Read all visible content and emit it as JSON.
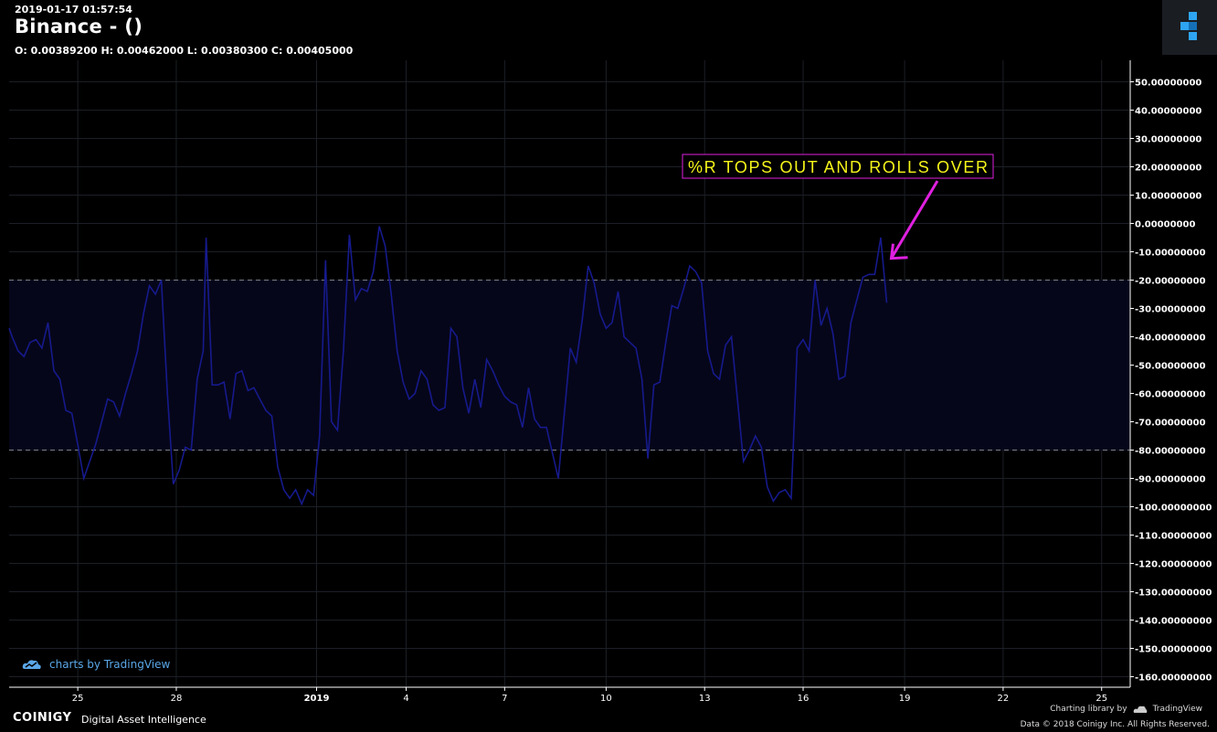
{
  "header": {
    "datetime": "2019-01-17 01:57:54",
    "title": "Binance -  ()",
    "ohlc": "O: 0.00389200 H: 0.00462000 L: 0.00380300 C: 0.00405000"
  },
  "annotation": {
    "text": "%R TOPS OUT AND ROLLS OVER",
    "text_color": "#f5f51a",
    "border_color": "#e020e0",
    "arrow_color": "#e020e0",
    "arrow_target": {
      "x": 101.0,
      "y": -12
    }
  },
  "footer": {
    "tradingview": "charts by TradingView",
    "brand": "COINIGY",
    "tagline": "Digital Asset Intelligence",
    "library_credit": "Charting library by",
    "library_name": "TradingView",
    "copyright": "Data © 2018   Coinigy Inc. All Rights Reserved."
  },
  "colors": {
    "background": "#000000",
    "grid": "#1c1f26",
    "line": "#161a8c",
    "band": "#06061a",
    "band_border": "#7a7f8c",
    "axis_text": "#ffffff"
  },
  "chart_data": {
    "type": "line",
    "title": "",
    "xlabel": "",
    "ylabel": "",
    "xlim": [
      78.4,
      113.8
    ],
    "ylim": [
      -165,
      58
    ],
    "y_ticks": [
      50,
      40,
      30,
      20,
      10,
      0,
      -10,
      -20,
      -30,
      -40,
      -50,
      -60,
      -70,
      -80,
      -90,
      -100,
      -110,
      -120,
      -130,
      -140,
      -150,
      -160
    ],
    "y_tick_labels": [
      "50.00000000",
      "40.00000000",
      "30.00000000",
      "20.00000000",
      "10.00000000",
      "0.00000000",
      "-10.00000000",
      "-20.00000000",
      "-30.00000000",
      "-40.00000000",
      "-50.00000000",
      "-60.00000000",
      "-70.00000000",
      "-80.00000000",
      "-90.00000000",
      "-100.00000000",
      "-110.00000000",
      "-120.00000000",
      "-130.00000000",
      "-140.00000000",
      "-150.00000000",
      "-160.00000000"
    ],
    "x_ticks": [
      {
        "x": 80.7,
        "label": "25"
      },
      {
        "x": 84.0,
        "label": "28"
      },
      {
        "x": 88.7,
        "label": "2019"
      },
      {
        "x": 91.7,
        "label": "4"
      },
      {
        "x": 95.0,
        "label": "7"
      },
      {
        "x": 98.4,
        "label": "10"
      },
      {
        "x": 101.7,
        "label": "13"
      },
      {
        "x": 105.0,
        "label": "16"
      },
      {
        "x": 108.4,
        "label": "19"
      },
      {
        "x": 111.7,
        "label": "22"
      },
      {
        "x": 115.0,
        "label": "25"
      }
    ],
    "grid": true,
    "reference_levels": [
      -20,
      -80
    ],
    "series": [
      {
        "values": [
          [
            78.4,
            -37
          ],
          [
            78.5,
            -40
          ],
          [
            78.7,
            -45
          ],
          [
            78.9,
            -47
          ],
          [
            79.1,
            -42
          ],
          [
            79.3,
            -41
          ],
          [
            79.5,
            -44
          ],
          [
            79.7,
            -35
          ],
          [
            79.9,
            -52
          ],
          [
            80.1,
            -55
          ],
          [
            80.3,
            -66
          ],
          [
            80.5,
            -67
          ],
          [
            80.7,
            -78
          ],
          [
            80.9,
            -90
          ],
          [
            81.1,
            -84
          ],
          [
            81.3,
            -78
          ],
          [
            81.5,
            -70
          ],
          [
            81.7,
            -62
          ],
          [
            81.9,
            -63
          ],
          [
            82.1,
            -68
          ],
          [
            82.3,
            -60
          ],
          [
            82.5,
            -53
          ],
          [
            82.7,
            -45
          ],
          [
            82.9,
            -32
          ],
          [
            83.1,
            -22
          ],
          [
            83.3,
            -25
          ],
          [
            83.5,
            -20
          ],
          [
            83.7,
            -60
          ],
          [
            83.9,
            -92
          ],
          [
            84.1,
            -87
          ],
          [
            84.3,
            -79
          ],
          [
            84.5,
            -80
          ],
          [
            84.7,
            -55
          ],
          [
            84.9,
            -45
          ],
          [
            85.0,
            -5
          ],
          [
            85.2,
            -57
          ],
          [
            85.4,
            -57
          ],
          [
            85.6,
            -56
          ],
          [
            85.8,
            -69
          ],
          [
            86.0,
            -53
          ],
          [
            86.2,
            -52
          ],
          [
            86.4,
            -59
          ],
          [
            86.6,
            -58
          ],
          [
            86.8,
            -62
          ],
          [
            87.0,
            -66
          ],
          [
            87.2,
            -68
          ],
          [
            87.4,
            -86
          ],
          [
            87.6,
            -94
          ],
          [
            87.8,
            -97
          ],
          [
            88.0,
            -94
          ],
          [
            88.2,
            -99
          ],
          [
            88.4,
            -94
          ],
          [
            88.6,
            -96
          ],
          [
            88.8,
            -75
          ],
          [
            89.0,
            -13
          ],
          [
            89.2,
            -70
          ],
          [
            89.4,
            -73
          ],
          [
            89.6,
            -45
          ],
          [
            89.8,
            -4
          ],
          [
            90.0,
            -27
          ],
          [
            90.2,
            -23
          ],
          [
            90.4,
            -24
          ],
          [
            90.6,
            -17
          ],
          [
            90.8,
            -1
          ],
          [
            91.0,
            -8
          ],
          [
            91.2,
            -25
          ],
          [
            91.4,
            -45
          ],
          [
            91.6,
            -56
          ],
          [
            91.8,
            -62
          ],
          [
            92.0,
            -60
          ],
          [
            92.2,
            -52
          ],
          [
            92.4,
            -55
          ],
          [
            92.6,
            -64
          ],
          [
            92.8,
            -66
          ],
          [
            93.0,
            -65
          ],
          [
            93.2,
            -37
          ],
          [
            93.4,
            -40
          ],
          [
            93.6,
            -58
          ],
          [
            93.8,
            -67
          ],
          [
            94.0,
            -55
          ],
          [
            94.2,
            -65
          ],
          [
            94.4,
            -48
          ],
          [
            94.6,
            -52
          ],
          [
            94.8,
            -57
          ],
          [
            95.0,
            -61
          ],
          [
            95.2,
            -63
          ],
          [
            95.4,
            -64
          ],
          [
            95.6,
            -72
          ],
          [
            95.8,
            -58
          ],
          [
            96.0,
            -69
          ],
          [
            96.2,
            -72
          ],
          [
            96.4,
            -72
          ],
          [
            96.6,
            -81
          ],
          [
            96.8,
            -90
          ],
          [
            97.0,
            -67
          ],
          [
            97.2,
            -44
          ],
          [
            97.4,
            -49
          ],
          [
            97.6,
            -34
          ],
          [
            97.8,
            -15
          ],
          [
            98.0,
            -21
          ],
          [
            98.2,
            -32
          ],
          [
            98.4,
            -37
          ],
          [
            98.6,
            -35
          ],
          [
            98.8,
            -24
          ],
          [
            99.0,
            -40
          ],
          [
            99.2,
            -42
          ],
          [
            99.4,
            -44
          ],
          [
            99.6,
            -55
          ],
          [
            99.8,
            -83
          ],
          [
            100.0,
            -57
          ],
          [
            100.2,
            -56
          ],
          [
            100.4,
            -42
          ],
          [
            100.6,
            -29
          ],
          [
            100.8,
            -30
          ],
          [
            101.0,
            -23
          ],
          [
            101.2,
            -15
          ],
          [
            101.4,
            -17
          ],
          [
            101.6,
            -21
          ],
          [
            101.8,
            -45
          ],
          [
            102.0,
            -53
          ],
          [
            102.2,
            -55
          ],
          [
            102.4,
            -43
          ],
          [
            102.6,
            -40
          ],
          [
            102.8,
            -62
          ],
          [
            103.0,
            -84
          ],
          [
            103.2,
            -80
          ],
          [
            103.4,
            -75
          ],
          [
            103.6,
            -79
          ],
          [
            103.8,
            -93
          ],
          [
            104.0,
            -98
          ],
          [
            104.2,
            -95
          ],
          [
            104.4,
            -94
          ],
          [
            104.6,
            -97
          ],
          [
            104.8,
            -44
          ],
          [
            105.0,
            -41
          ],
          [
            105.2,
            -45
          ],
          [
            105.4,
            -20
          ],
          [
            105.6,
            -36
          ],
          [
            105.8,
            -30
          ],
          [
            106.0,
            -39
          ],
          [
            106.2,
            -55
          ],
          [
            106.4,
            -54
          ],
          [
            106.6,
            -35
          ],
          [
            106.8,
            -27
          ],
          [
            107.0,
            -19
          ],
          [
            107.2,
            -18
          ],
          [
            107.4,
            -18
          ],
          [
            107.6,
            -5
          ],
          [
            107.8,
            -28
          ]
        ]
      }
    ]
  }
}
